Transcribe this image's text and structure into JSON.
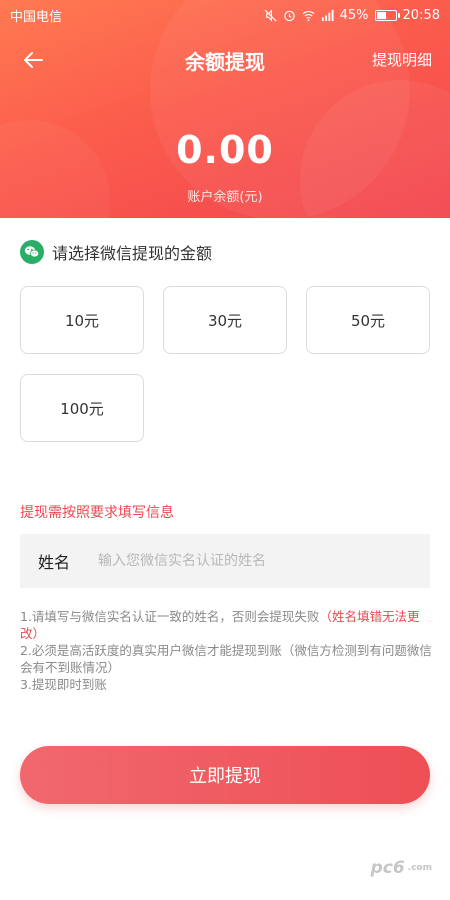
{
  "status_bar": {
    "carrier": "中国电信",
    "battery": "45%",
    "time": "20:58",
    "battery_level": 0.45
  },
  "navbar": {
    "title": "余额提现",
    "right_link": "提现明细"
  },
  "balance": {
    "amount": "0.00",
    "label": "账户余额(元)"
  },
  "select": {
    "title": "请选择微信提现的金额",
    "amounts": [
      "10元",
      "30元",
      "50元",
      "100元"
    ]
  },
  "form": {
    "heading": "提现需按照要求填写信息",
    "name_label": "姓名",
    "name_placeholder": "输入您微信实名认证的姓名",
    "name_value": ""
  },
  "notes": {
    "line1": "1.请填写与微信实名认证一致的姓名，否则会提现失败",
    "line1_red": "（姓名填错无法更改）",
    "line2": "2.必须是高活跃度的真实用户微信才能提现到账（微信方检测到有问题微信会有不到账情况）",
    "line3": "3.提现即时到账"
  },
  "submit_label": "立即提现",
  "watermark": {
    "logo": "pc6",
    "sub": ".com"
  },
  "colors": {
    "accent": "#ee4f55",
    "wechat": "#2aae67"
  }
}
